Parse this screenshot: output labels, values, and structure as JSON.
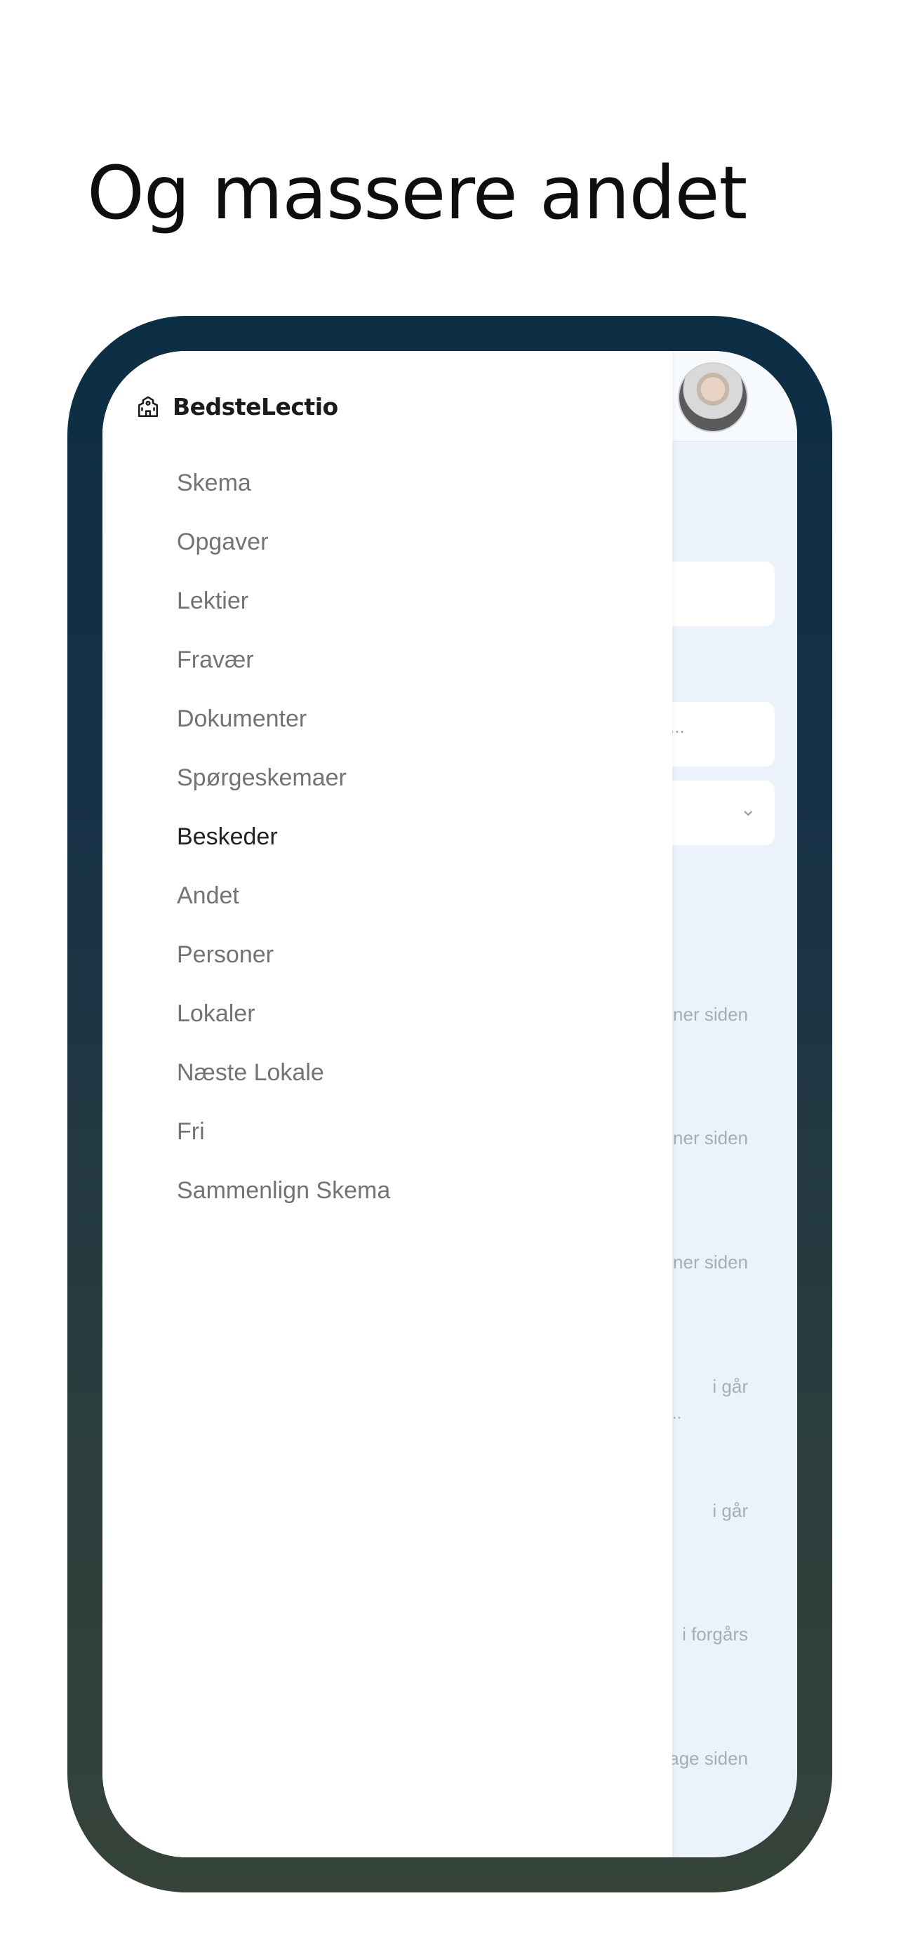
{
  "headline": "Og massere andet",
  "app": {
    "brand_name": "BedsteLectio",
    "brand_icon": "school-building-icon"
  },
  "nav": {
    "items": [
      {
        "label": "Skema",
        "active": false
      },
      {
        "label": "Opgaver",
        "active": false
      },
      {
        "label": "Lektier",
        "active": false
      },
      {
        "label": "Fravær",
        "active": false
      },
      {
        "label": "Dokumenter",
        "active": false
      },
      {
        "label": "Spørgeskemaer",
        "active": false
      },
      {
        "label": "Beskeder",
        "active": true
      },
      {
        "label": "Andet",
        "active": false
      },
      {
        "label": "Personer",
        "active": false
      },
      {
        "label": "Lokaler",
        "active": false
      },
      {
        "label": "Næste Lokale",
        "active": false
      },
      {
        "label": "Fri",
        "active": false
      },
      {
        "label": "Sammenlign Skema",
        "active": false
      }
    ]
  },
  "background": {
    "search_placeholder_fragment": "...",
    "message_times": [
      "ner siden",
      "ner siden",
      "ner siden",
      "i går",
      "i går",
      "i forgårs",
      "age siden"
    ],
    "truncation": ".."
  },
  "colors": {
    "frame_top": "#0c2e44",
    "frame_bottom": "#354339",
    "screen_background": "#ecf2fb",
    "nav_text": "#737373",
    "nav_active_text": "#222222"
  }
}
